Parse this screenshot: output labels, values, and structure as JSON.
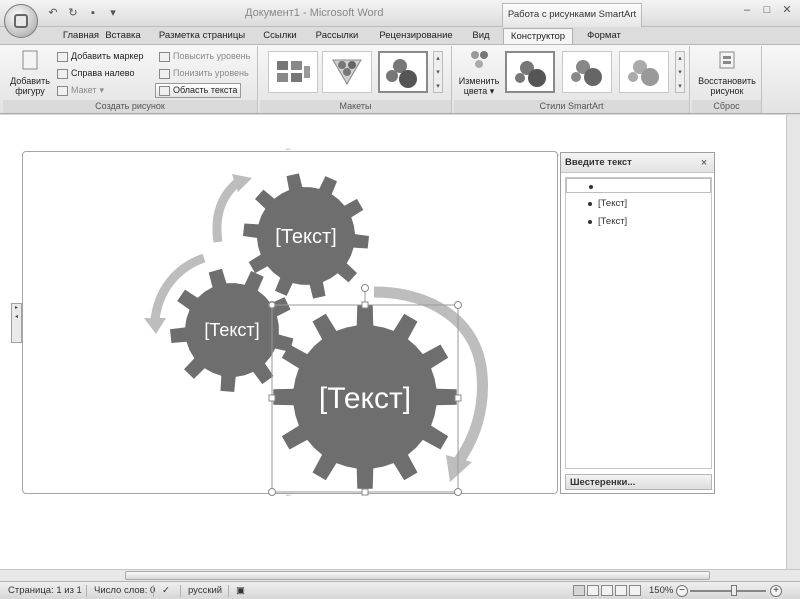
{
  "window": {
    "title": "Документ1 - Microsoft Word",
    "context_tab_group": "Работа с рисунками SmartArt"
  },
  "qat": {
    "undo_glyph": "↶",
    "redo_glyph": "↻",
    "save_glyph": "▪",
    "customize_glyph": "▾"
  },
  "window_controls": {
    "minimize": "–",
    "maximize": "□",
    "close": "✕"
  },
  "tabs": [
    {
      "label": "Главная"
    },
    {
      "label": "Вставка"
    },
    {
      "label": "Разметка страницы"
    },
    {
      "label": "Ссылки"
    },
    {
      "label": "Рассылки"
    },
    {
      "label": "Рецензирование"
    },
    {
      "label": "Вид"
    },
    {
      "label": "Конструктор",
      "active": true
    },
    {
      "label": "Формат"
    }
  ],
  "ribbon": {
    "create_group": {
      "label": "Создать рисунок",
      "add_shape": "Добавить фигуру",
      "add_bullet": "Добавить маркер",
      "right_to_left": "Справа налево",
      "layout": "Макет",
      "promote": "Повысить уровень",
      "demote": "Понизить уровень",
      "text_pane": "Область текста"
    },
    "layouts_group": {
      "label": "Макеты"
    },
    "styles_group": {
      "label": "Стили SmartArt",
      "change_colors": "Изменить цвета"
    },
    "reset_group": {
      "label": "Сброс",
      "reset_graphic": "Восстановить рисунок"
    }
  },
  "smartart": {
    "gear_labels": [
      "[Текст]",
      "[Текст]",
      "[Текст]"
    ],
    "gear_color": "#6e6e6e",
    "arrow_color": "#bdbdbd"
  },
  "text_pane": {
    "title": "Введите текст",
    "close_glyph": "×",
    "items": [
      "",
      "[Текст]",
      "[Текст]"
    ],
    "footer": "Шестеренки..."
  },
  "statusbar": {
    "page": "Страница: 1 из 1",
    "words": "Число слов: 0",
    "language": "русский",
    "zoom": "150%",
    "zoom_out": "−",
    "zoom_in": "+"
  }
}
